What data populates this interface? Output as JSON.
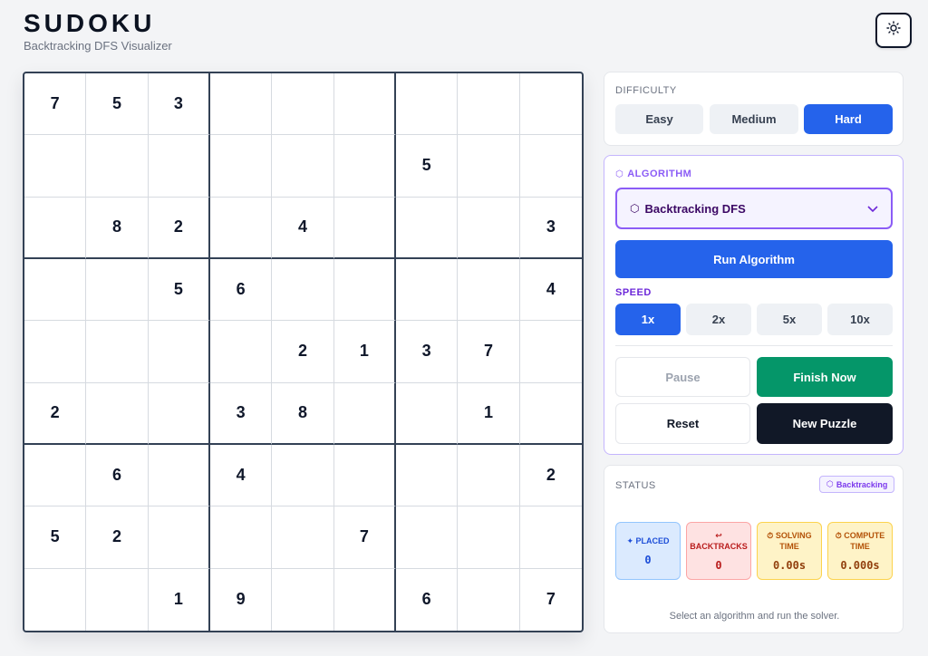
{
  "header": {
    "title": "SUDOKU",
    "subtitle": "Backtracking DFS Visualizer"
  },
  "board": {
    "rows": [
      [
        "7",
        "5",
        "3",
        "",
        "",
        "",
        "",
        "",
        ""
      ],
      [
        "",
        "",
        "",
        "",
        "",
        "",
        "5",
        "",
        ""
      ],
      [
        "",
        "8",
        "2",
        "",
        "4",
        "",
        "",
        "",
        "3"
      ],
      [
        "",
        "",
        "5",
        "6",
        "",
        "",
        "",
        "",
        "4"
      ],
      [
        "",
        "",
        "",
        "",
        "2",
        "1",
        "3",
        "7",
        ""
      ],
      [
        "2",
        "",
        "",
        "3",
        "8",
        "",
        "",
        "1",
        ""
      ],
      [
        "",
        "6",
        "",
        "4",
        "",
        "",
        "",
        "",
        "2"
      ],
      [
        "5",
        "2",
        "",
        "",
        "",
        "7",
        "",
        "",
        ""
      ],
      [
        "",
        "",
        "1",
        "9",
        "",
        "",
        "6",
        "",
        "7"
      ]
    ]
  },
  "difficulty": {
    "label": "DIFFICULTY",
    "options": [
      "Easy",
      "Medium",
      "Hard"
    ],
    "selected": "Hard"
  },
  "algorithm": {
    "label": "ALGORITHM",
    "selected": "Backtracking DFS",
    "run_label": "Run Algorithm"
  },
  "speed": {
    "label": "SPEED",
    "options": [
      "1x",
      "2x",
      "5x",
      "10x"
    ],
    "selected": "1x"
  },
  "controls": {
    "pause": "Pause",
    "finish": "Finish Now",
    "reset": "Reset",
    "new_puzzle": "New Puzzle"
  },
  "status": {
    "label": "STATUS",
    "badge": "Backtracking",
    "stats": {
      "placed_label": "PLACED",
      "placed_value": "0",
      "backtracks_label": "BACKTRACKS",
      "backtracks_value": "0",
      "solving_label": "SOLVING TIME",
      "solving_value": "0.00s",
      "compute_label": "COMPUTE TIME",
      "compute_value": "0.000s"
    },
    "message": "Select an algorithm and run the solver."
  },
  "colors": {
    "accent": "#2563eb",
    "purple": "#8b5cf6",
    "green": "#059669",
    "dark": "#111827"
  }
}
